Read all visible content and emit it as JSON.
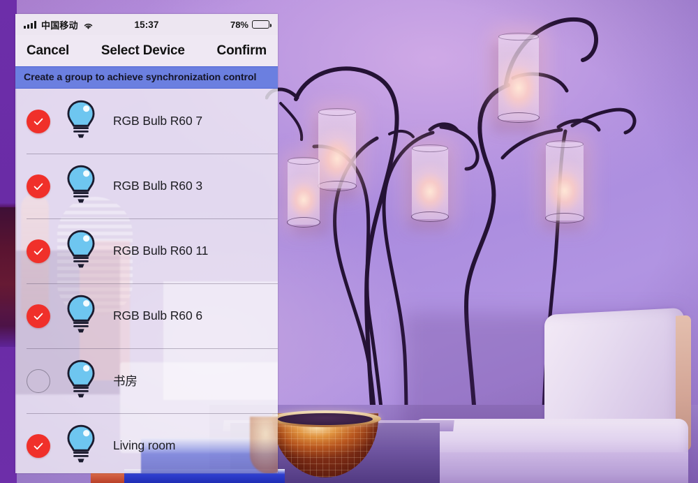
{
  "statusbar": {
    "signal_icon": "cellular-signal-icon",
    "carrier": "中国移动",
    "wifi_icon": "wifi-icon",
    "time": "15:37",
    "battery_percent": "78%",
    "battery_icon": "battery-icon",
    "battery_level": 78
  },
  "navbar": {
    "cancel_label": "Cancel",
    "title": "Select Device",
    "confirm_label": "Confirm"
  },
  "banner": {
    "text": "Create a group to achieve synchronization control",
    "color": "#6B7FE0"
  },
  "colors": {
    "checked": "#F0302A",
    "bulb": "#6EC6F0",
    "panel": "#EEE9F3",
    "text": "#1d1d22"
  },
  "devices": [
    {
      "name": "RGB Bulb R60 7",
      "selected": true,
      "icon": "lightbulb-icon",
      "check_icon": "check-circle-icon"
    },
    {
      "name": "RGB Bulb R60 3",
      "selected": true,
      "icon": "lightbulb-icon",
      "check_icon": "check-circle-icon"
    },
    {
      "name": "RGB Bulb R60 11",
      "selected": true,
      "icon": "lightbulb-icon",
      "check_icon": "check-circle-icon"
    },
    {
      "name": "RGB Bulb R60 6",
      "selected": true,
      "icon": "lightbulb-icon",
      "check_icon": "check-circle-icon"
    },
    {
      "name": "书房",
      "selected": false,
      "icon": "lightbulb-icon",
      "check_icon": "empty-circle-icon"
    },
    {
      "name": "Living room",
      "selected": true,
      "icon": "lightbulb-icon",
      "check_icon": "check-circle-icon"
    }
  ],
  "background": {
    "description": "purple-lit interior with branch wall lamp, armchair and mosaic bowl",
    "lamp_shade_count": 5
  }
}
